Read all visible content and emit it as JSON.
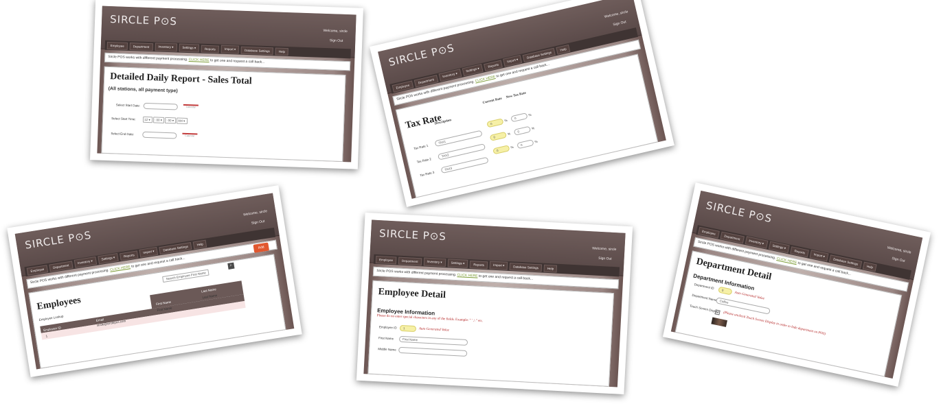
{
  "app": {
    "logo": "SIRCLE P⊙S",
    "welcome": "Welcome, sircle",
    "signout": "Sign Out",
    "nav": [
      "Employee",
      "Department",
      "Inventory ▾",
      "Settings ▾",
      "Reports",
      "Import ▾",
      "Database Settings",
      "Help"
    ],
    "notice_pre": "Sircle POS works with different payment processing.",
    "notice_link": "CLICK HERE",
    "notice_post": "to get one and request a call back..."
  },
  "report": {
    "title": "Detailed Daily Report - Sales Total",
    "subtitle": "(All stations, all payment type)",
    "start_date_label": "Select Start Date:",
    "start_time_label": "Select Start Time:",
    "end_date_label": "Select End Date:",
    "hour": "12 ▾",
    "minute": ": 00 ▾",
    "second": ": 00 ▾",
    "ampm": "AM ▾",
    "calendar_label": "Calendar"
  },
  "tax": {
    "title": "Tax Rate",
    "col_description": "Description",
    "col_current": "Current Rate",
    "col_new": "New Tax Rate",
    "rows": [
      {
        "label": "Tax Rate 1",
        "description": "TAX1",
        "current": "0",
        "new": "0"
      },
      {
        "label": "Tax Rate 2",
        "description": "TAX2",
        "current": "0",
        "new": "0"
      },
      {
        "label": "Tax Rate 3",
        "description": "TAX3",
        "current": "0",
        "new": "0"
      }
    ],
    "pct": "%"
  },
  "employees": {
    "title": "Employees",
    "add_label": "Add",
    "search_placeholder": "Search Employee First Name",
    "lookup_label": "Employee Lookup",
    "col_id": "Employee ID",
    "col_email": "Email",
    "col_first": "First Name",
    "col_last": "Last Name",
    "row_id": "1",
    "row_email": "sircle@circlepos.com",
    "row_first": "First Name",
    "row_last": "Last Name"
  },
  "emp_detail": {
    "title": "Employee Detail",
    "section": "Employee Information",
    "warning": "Please do no enter special characters in any of the fields. Example: \" ' ,\\ \" etc.",
    "id_label": "Employee ID",
    "id_value": "1",
    "auto": "Auto Generated Value",
    "first_label": "First Name",
    "first_placeholder": "First Name",
    "middle_label": "Middle Name"
  },
  "dept": {
    "title": "Department Detail",
    "section": "Department Information",
    "id_label": "Department ID",
    "id_value": "0",
    "auto": "Auto Generated Value",
    "name_label": "Department Name",
    "name_value": "Coffee",
    "touch_label": "Touch Screen Display",
    "touch_note": "(Please uncheck Touch Screen Display in order to hide department on POS)"
  },
  "colors": {
    "header": "#574746",
    "accent_button": "#e1572f",
    "link": "#7b9b34",
    "warning": "#b11d1d",
    "highlight_input": "#f6f0a6"
  }
}
